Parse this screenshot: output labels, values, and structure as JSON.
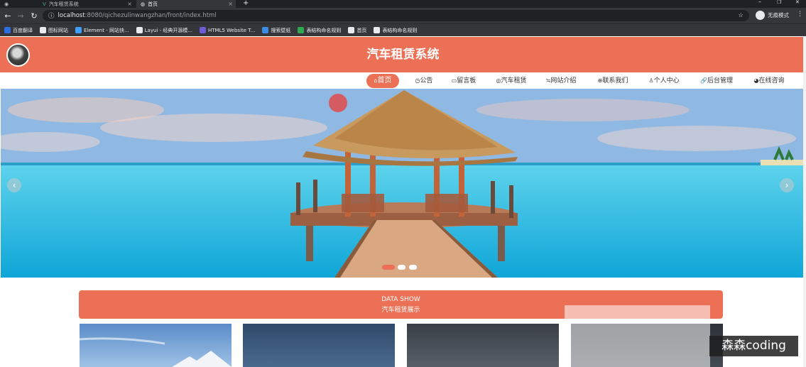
{
  "browser": {
    "tabs": [
      {
        "title": "汽车租赁系统",
        "icon_color": "#41b883"
      },
      {
        "title": "首页",
        "icon_color": "#e8eaed"
      }
    ],
    "new_tab_symbol": "+",
    "url_host": "localhost",
    "url_rest": ":8080/qichezulinwangzhan/front/index.html",
    "profile_label": "无痕模式",
    "window_controls": [
      "–",
      "❐",
      "✕"
    ],
    "bookmarks": [
      {
        "label": "百度翻译",
        "color": "#2b6fe3"
      },
      {
        "label": "图标网站",
        "color": "#e8eaed"
      },
      {
        "label": "Element - 网站快...",
        "color": "#409eff"
      },
      {
        "label": "Layui - 经典开源模...",
        "color": "#e8eaed"
      },
      {
        "label": "HTML5 Website T...",
        "color": "#6e5bd6"
      },
      {
        "label": "搜索壁纸",
        "color": "#3a8ee6"
      },
      {
        "label": "表结构命名规则",
        "color": "#2fa84f"
      },
      {
        "label": "首页",
        "color": "#e8eaed"
      },
      {
        "label": "表结构命名规则",
        "color": "#e8eaed"
      }
    ]
  },
  "site": {
    "title": "汽车租赁系统",
    "accent": "#ec7055",
    "nav": [
      {
        "label": "首页",
        "icon": "home-icon",
        "glyph": "⌂",
        "active": true
      },
      {
        "label": "公告",
        "icon": "notice-icon",
        "glyph": "◷",
        "active": false
      },
      {
        "label": "留言板",
        "icon": "message-icon",
        "glyph": "▭",
        "active": false
      },
      {
        "label": "汽车租赁",
        "icon": "car-icon",
        "glyph": "◎",
        "active": false
      },
      {
        "label": "网站介绍",
        "icon": "info-icon",
        "glyph": "≒",
        "active": false
      },
      {
        "label": "联系我们",
        "icon": "contact-icon",
        "glyph": "⊕",
        "active": false
      },
      {
        "label": "个人中心",
        "icon": "user-icon",
        "glyph": "♙",
        "active": false
      },
      {
        "label": "后台管理",
        "icon": "link-icon",
        "glyph": "🔗",
        "active": false
      },
      {
        "label": "在线咨询",
        "icon": "chat-icon",
        "glyph": "◕",
        "active": false
      }
    ],
    "carousel": {
      "prev": "‹",
      "next": "›",
      "slide_count": 3,
      "active_slide": 0
    },
    "data_show": {
      "en": "DATA SHOW",
      "cn": "汽车租赁展示"
    }
  },
  "watermark": "森森coding"
}
